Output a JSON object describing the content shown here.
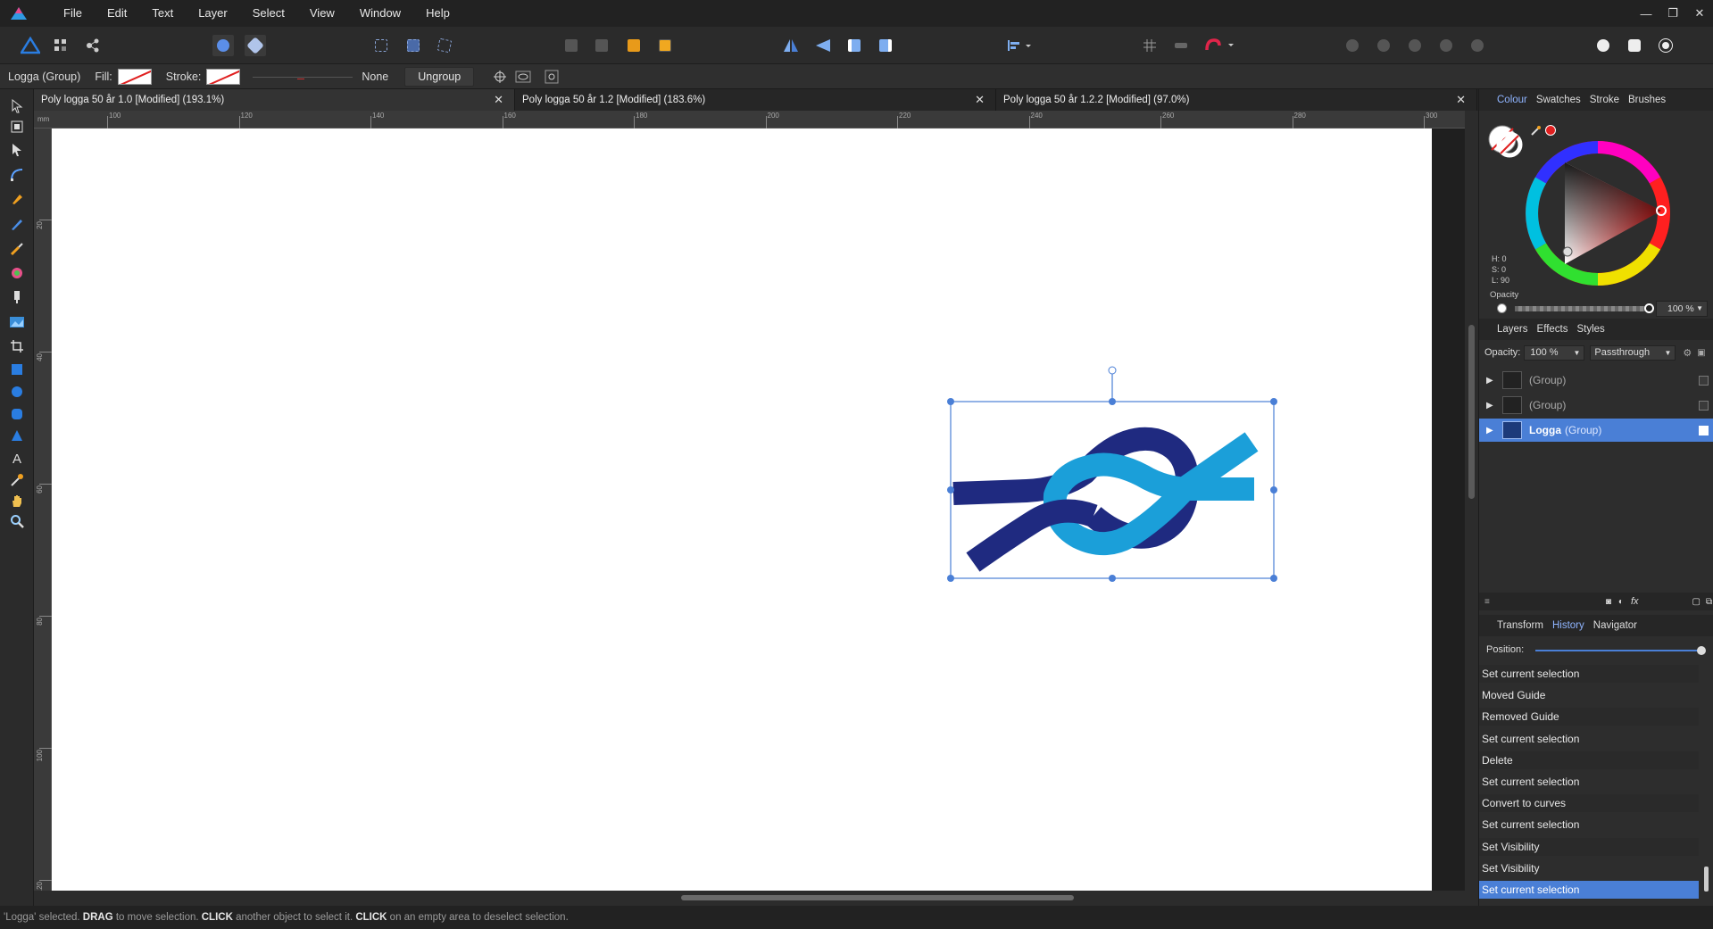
{
  "menubar": {
    "items": [
      "File",
      "Edit",
      "Text",
      "Layer",
      "Select",
      "View",
      "Window",
      "Help"
    ]
  },
  "window_controls": [
    "—",
    "❐",
    "✕"
  ],
  "context_bar": {
    "selection_label": "Logga (Group)",
    "fill_label": "Fill:",
    "stroke_label": "Stroke:",
    "stroke_style": "None",
    "ungroup_label": "Ungroup"
  },
  "tabs": [
    {
      "title": "Poly logga 50 år 1.0 [Modified] (193.1%)",
      "active": true
    },
    {
      "title": "Poly logga 50 år 1.2 [Modified] (183.6%)",
      "active": false
    },
    {
      "title": "Poly logga 50 år 1.2.2 [Modified] (97.0%)",
      "active": false
    }
  ],
  "tab_close": "✕",
  "ruler": {
    "unit": "mm",
    "h_ticks": [
      "100",
      "120",
      "140",
      "160",
      "180",
      "200",
      "220",
      "240",
      "260",
      "280",
      "300"
    ],
    "v_ticks": [
      "20",
      "40",
      "60",
      "80",
      "100",
      "120"
    ]
  },
  "colour_panel": {
    "tabs": [
      "Colour",
      "Swatches",
      "Stroke",
      "Brushes"
    ],
    "active_tab": "Colour",
    "h": "H: 0",
    "s": "S: 0",
    "l": "L: 90",
    "opacity_label": "Opacity",
    "opacity_value": "100 %",
    "opacity_fraction": 1.0,
    "accent": "#e02020"
  },
  "layers_panel": {
    "tabs": [
      "Layers",
      "Effects",
      "Styles"
    ],
    "active_tab": "Layers",
    "opacity_label": "Opacity:",
    "opacity_value": "100 %",
    "blend_mode": "Passthrough",
    "rows": [
      {
        "name": "",
        "type": "(Group)",
        "selected": false
      },
      {
        "name": "",
        "type": "(Group)",
        "selected": false
      },
      {
        "name": "Logga",
        "type": "(Group)",
        "selected": true
      }
    ]
  },
  "history_panel": {
    "tabs": [
      "Transform",
      "History",
      "Navigator"
    ],
    "active_tab": "History",
    "position_label": "Position:",
    "position_fraction": 1.0,
    "items": [
      "Set current selection",
      "Moved Guide",
      "Removed Guide",
      "Set current selection",
      "Delete",
      "Set current selection",
      "Convert to curves",
      "Set current selection",
      "Set Visibility",
      "Set Visibility",
      "Set current selection"
    ],
    "selected_index": 10
  },
  "logo": {
    "dark_blue": "#1f2a80",
    "light_blue": "#1b9fd9"
  },
  "status": {
    "prefix": "'Logga' selected. ",
    "k1": "DRAG",
    "t1": " to move selection. ",
    "k2": "CLICK",
    "t2": " another object to select it. ",
    "k3": "CLICK",
    "t3": " on an empty area to deselect selection."
  }
}
